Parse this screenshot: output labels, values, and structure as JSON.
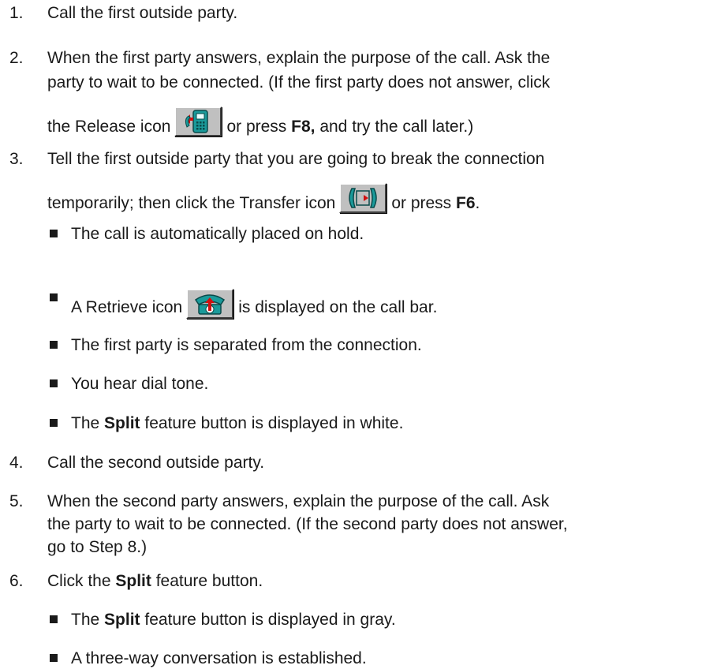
{
  "steps": [
    {
      "num": "1.",
      "lines": [
        "Call the first outside party."
      ]
    },
    {
      "num": "2.",
      "lines": [
        "When the first party answers, explain the purpose of the call.  Ask the",
        "party to wait to be connected.  (If the first party does not answer, click"
      ],
      "line3": {
        "pre": "the Release icon",
        "mid": "or press",
        "key": "F8,",
        "post": "and try the call later.)"
      }
    },
    {
      "num": "3.",
      "lines": [
        "Tell the first outside party that you are going to break the connection"
      ],
      "line2": {
        "pre": "temporarily; then click the Transfer icon",
        "mid": "or press",
        "key": "F6",
        "post": "."
      },
      "bullets": [
        {
          "text": "The call is automatically placed on hold."
        },
        {
          "pre": "A Retrieve icon",
          "post": "is displayed on the call bar."
        },
        {
          "text": "The first party is separated from the connection."
        },
        {
          "text": "You hear dial tone."
        },
        {
          "pre": "The",
          "bold": "Split",
          "post": "feature button is displayed in white."
        }
      ]
    },
    {
      "num": "4.",
      "lines": [
        "Call the second outside party."
      ]
    },
    {
      "num": "5.",
      "lines": [
        "When the second party answers, explain the purpose of the call.  Ask",
        "the party to wait to be connected.  (If the second party does not answer,",
        "go to Step 8.)"
      ]
    },
    {
      "num": "6.",
      "pre": "Click the",
      "bold": "Split",
      "post": "feature button.",
      "bullets": [
        {
          "pre": "The",
          "bold": "Split",
          "post": "feature button is displayed in gray."
        },
        {
          "text": "A three-way conversation is established."
        }
      ]
    }
  ],
  "icons": {
    "release": "release-icon",
    "transfer": "transfer-icon",
    "retrieve": "retrieve-icon"
  },
  "colors": {
    "icon_face": "#c0c0c0",
    "phone_teal": "#1a9a9a",
    "arrow_red": "#d01010"
  }
}
